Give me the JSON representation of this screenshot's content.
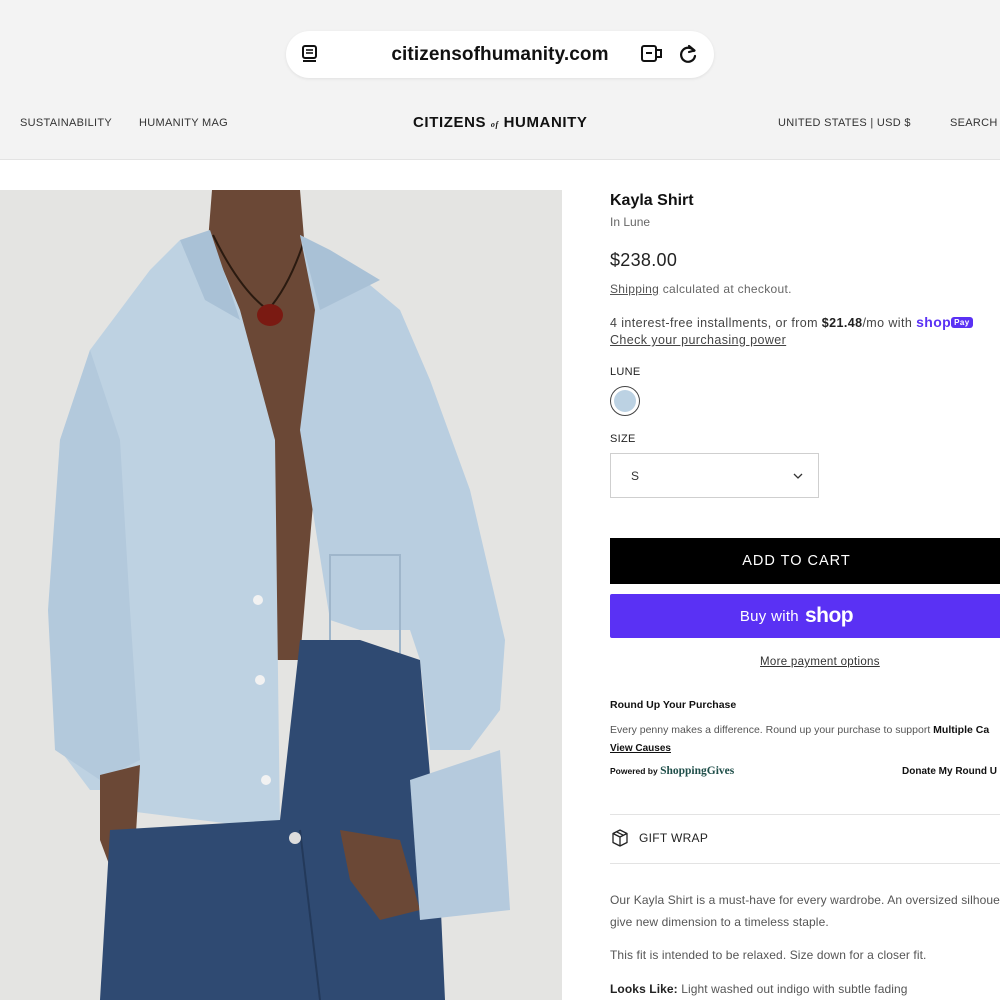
{
  "browser": {
    "url": "citizensofhumanity.com",
    "icons": [
      "reader-mode-icon",
      "extension-icon",
      "reload-icon"
    ]
  },
  "header": {
    "nav_left": [
      "SUSTAINABILITY",
      "HUMANITY MAG"
    ],
    "logo_part1": "CITIZENS",
    "logo_of": "of",
    "logo_part2": "HUMANITY",
    "region": "UNITED STATES | USD $",
    "search": "SEARCH"
  },
  "product": {
    "title": "Kayla Shirt",
    "subtitle": "In Lune",
    "price": "$238.00",
    "shipping_link": "Shipping",
    "shipping_rest": " calculated at checkout.",
    "installments_prefix": "4 interest-free installments, or from ",
    "installments_amount": "$21.48",
    "installments_suffix": "/mo with ",
    "shoppay_brand": "shop",
    "shoppay_pay": "Pay",
    "check_power": "Check your purchasing power",
    "color_label": "LUNE",
    "swatch_color": "#bcd2e3",
    "size_label": "SIZE",
    "size_value": "S",
    "add_to_cart": "ADD TO CART",
    "buy_with": "Buy with",
    "buy_brand": "shop",
    "more_payment": "More payment options",
    "accent_purple": "#5a31f4"
  },
  "roundup": {
    "title": "Round Up Your Purchase",
    "desc": "Every penny makes a difference. Round up your purchase to support ",
    "desc_bold": "Multiple Ca",
    "view_causes": "View Causes",
    "powered_by": "Powered by ",
    "powered_brand": "ShoppingGives",
    "donate": "Donate My Round U"
  },
  "gift_wrap": "GIFT WRAP",
  "description": {
    "line1": "Our Kayla Shirt is a must-have for every wardrobe. An oversized silhouette",
    "line2": "give new dimension to a timeless staple.",
    "line3": "This fit is intended to be relaxed. Size down for a closer fit.",
    "looks_label": "Looks Like:",
    "looks_value": " Light washed out indigo with subtle fading"
  },
  "image": {
    "alt": "Model wearing light blue oversized denim Kayla Shirt with dark jeans"
  }
}
